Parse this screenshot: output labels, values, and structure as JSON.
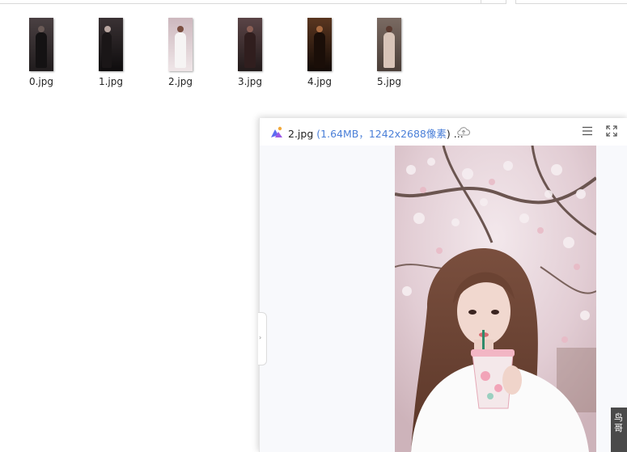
{
  "files": [
    {
      "name": "0.jpg",
      "palette": [
        "#3a3536",
        "#1c1a1b",
        "#7a6a6c"
      ]
    },
    {
      "name": "1.jpg",
      "palette": [
        "#2b2424",
        "#0f0d0e",
        "#c9b8b4"
      ]
    },
    {
      "name": "2.jpg",
      "palette": [
        "#d9c7cb",
        "#f2ecec",
        "#8a5a4a"
      ]
    },
    {
      "name": "3.jpg",
      "palette": [
        "#4a3434",
        "#1e1818",
        "#9a6a60"
      ]
    },
    {
      "name": "4.jpg",
      "palette": [
        "#3a2416",
        "#140c08",
        "#c58a5a"
      ]
    },
    {
      "name": "5.jpg",
      "palette": [
        "#6a5a52",
        "#3a302c",
        "#c8a898"
      ]
    }
  ],
  "preview": {
    "filename": "2.jpg",
    "open_paren": " (",
    "size": "1.64MB",
    "separator": "，",
    "dimensions": "1242x2688像素",
    "close": ") ...",
    "icons": {
      "app": "image-viewer-icon",
      "cloud": "cloud-upload-icon",
      "menu": "menu-icon",
      "fullscreen": "fullscreen-icon",
      "collapse": "chevron-right-icon"
    }
  },
  "corner_tag": "鸟哥",
  "colors": {
    "accent": "#4a7fd8",
    "preview_bg": "#f8f9fc"
  }
}
